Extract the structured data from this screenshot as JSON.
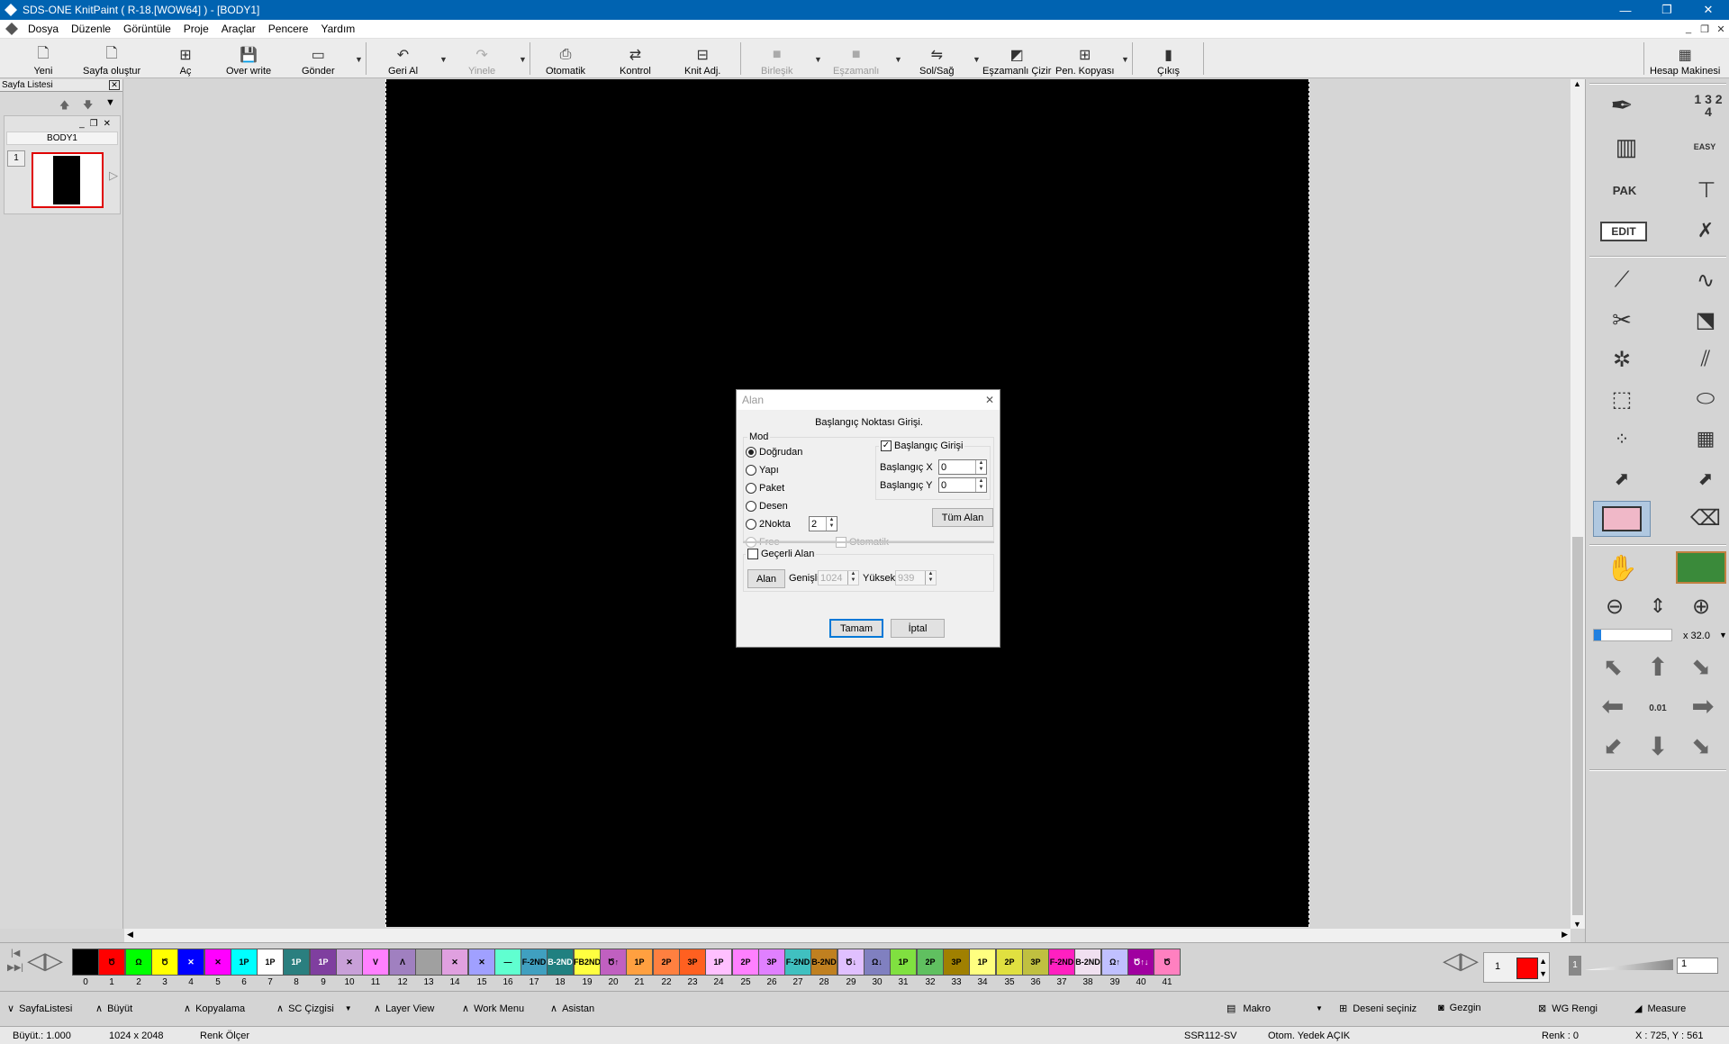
{
  "app": {
    "title": "SDS-ONE KnitPaint ( R-18.[WOW64] ) - [BODY1]"
  },
  "menu": [
    "Dosya",
    "Düzenle",
    "Görüntüle",
    "Proje",
    "Araçlar",
    "Pencere",
    "Yardım"
  ],
  "toolbar": {
    "yeni": "Yeni",
    "sayfa": "Sayfa oluştur",
    "ac": "Aç",
    "overwrite": "Over write",
    "gonder": "Gönder",
    "geri": "Geri Al",
    "yinele": "Yinele",
    "otomatik": "Otomatik",
    "kontrol": "Kontrol",
    "knit": "Knit Adj.",
    "birlesik": "Birleşik",
    "eszamanli": "Eşzamanlı",
    "solsag": "Sol/Sağ",
    "eszcizir": "Eşzamanlı Çizir",
    "penkopya": "Pen. Kopyası",
    "cikis": "Çıkış",
    "hesap": "Hesap Makinesi"
  },
  "left_panel": {
    "title": "Sayfa Listesi",
    "page_name": "BODY1",
    "page_number": "1"
  },
  "right_panel": {
    "edit_label": "EDIT",
    "easy_label": "EASY",
    "pak_label": "PAK",
    "num_label": "1 3 2 4",
    "zoom": "x 32.0",
    "step_label": "0.01"
  },
  "dialog": {
    "title": "Alan",
    "heading": "Başlangıç Noktası Girişi.",
    "mod_label": "Mod",
    "modes": [
      "Doğrudan",
      "Yapı",
      "Paket",
      "Desen",
      "2Nokta",
      "Free"
    ],
    "two_point_value": "2",
    "otomatik": "Otomatik",
    "start_entry": "Başlangıç Girişi",
    "start_x_label": "Başlangıç X",
    "start_x": "0",
    "start_y_label": "Başlangıç Y",
    "start_y": "0",
    "all_area": "Tüm Alan",
    "current_area": "Geçerli Alan",
    "alan_btn": "Alan",
    "width_label": "Genişlik",
    "width": "1024",
    "height_label": "Yükseklik",
    "height": "939",
    "ok": "Tamam",
    "cancel": "İptal"
  },
  "palette": [
    {
      "n": "0",
      "c": "#000000",
      "t": ""
    },
    {
      "n": "1",
      "c": "#ff0000",
      "t": "Ծ"
    },
    {
      "n": "2",
      "c": "#00ff00",
      "t": "Ω"
    },
    {
      "n": "3",
      "c": "#ffff00",
      "t": "Ծ"
    },
    {
      "n": "4",
      "c": "#0000ff",
      "t": "✕"
    },
    {
      "n": "5",
      "c": "#ff00ff",
      "t": "✕"
    },
    {
      "n": "6",
      "c": "#00ffff",
      "t": "1P"
    },
    {
      "n": "7",
      "c": "#ffffff",
      "t": "1P"
    },
    {
      "n": "8",
      "c": "#2a7f7f",
      "t": "1P"
    },
    {
      "n": "9",
      "c": "#7f3f9f",
      "t": "1P"
    },
    {
      "n": "10",
      "c": "#c8a0d8",
      "t": "✕"
    },
    {
      "n": "11",
      "c": "#ff80ff",
      "t": "V"
    },
    {
      "n": "12",
      "c": "#a080c0",
      "t": "Λ"
    },
    {
      "n": "13",
      "c": "#a0a0a0",
      "t": ""
    },
    {
      "n": "14",
      "c": "#e0a0e0",
      "t": "✕"
    },
    {
      "n": "15",
      "c": "#a0a0ff",
      "t": "✕"
    },
    {
      "n": "16",
      "c": "#60ffd0",
      "t": "—"
    },
    {
      "n": "17",
      "c": "#40a0c0",
      "t": "F-2ND"
    },
    {
      "n": "18",
      "c": "#208080",
      "t": "B-2ND"
    },
    {
      "n": "19",
      "c": "#ffff40",
      "t": "FB2ND"
    },
    {
      "n": "20",
      "c": "#c060c0",
      "t": "Ծ↑"
    },
    {
      "n": "21",
      "c": "#ffa040",
      "t": "1P"
    },
    {
      "n": "22",
      "c": "#ff8040",
      "t": "2P"
    },
    {
      "n": "23",
      "c": "#ff6020",
      "t": "3P"
    },
    {
      "n": "24",
      "c": "#ffc0ff",
      "t": "1P"
    },
    {
      "n": "25",
      "c": "#ff80ff",
      "t": "2P"
    },
    {
      "n": "26",
      "c": "#e080ff",
      "t": "3P"
    },
    {
      "n": "27",
      "c": "#40c0c0",
      "t": "F-2ND"
    },
    {
      "n": "28",
      "c": "#c08020",
      "t": "B-2ND"
    },
    {
      "n": "29",
      "c": "#e0c0ff",
      "t": "Ծ↓"
    },
    {
      "n": "30",
      "c": "#8080c0",
      "t": "Ω↓"
    },
    {
      "n": "31",
      "c": "#80e040",
      "t": "1P"
    },
    {
      "n": "32",
      "c": "#60c060",
      "t": "2P"
    },
    {
      "n": "33",
      "c": "#a08000",
      "t": "3P"
    },
    {
      "n": "34",
      "c": "#ffff80",
      "t": "1P"
    },
    {
      "n": "35",
      "c": "#e0e040",
      "t": "2P"
    },
    {
      "n": "36",
      "c": "#c0c040",
      "t": "3P"
    },
    {
      "n": "37",
      "c": "#ff20c0",
      "t": "F-2ND"
    },
    {
      "n": "38",
      "c": "#f0e0f0",
      "t": "B-2ND"
    },
    {
      "n": "39",
      "c": "#c0c0ff",
      "t": "Ω↑"
    },
    {
      "n": "40",
      "c": "#a000a0",
      "t": "Ծ↑↓"
    },
    {
      "n": "41",
      "c": "#ff80c0",
      "t": "Ծ"
    }
  ],
  "palette_right": {
    "num": "1",
    "level": "1",
    "current_color": "#ff0000"
  },
  "bottom": {
    "sayfalistesi": "SayfaListesi",
    "buyut": "Büyüt",
    "kopyalama": "Kopyalama",
    "sc": "SC Çizgisi",
    "layer": "Layer View",
    "work": "Work Menu",
    "asistan": "Asistan",
    "makro": "Makro",
    "deseni": "Deseni seçiniz",
    "gezgin": "Gezgin",
    "wg": "WG Rengi",
    "measure": "Measure"
  },
  "status": {
    "zoom": "Büyüt.: 1.000",
    "size": "1024 x 2048",
    "renk_olcer": "Renk Ölçer",
    "model": "SSR112-SV",
    "yedek": "Otom. Yedek AÇIK",
    "renk": "Renk :  0",
    "coords": "X : 725, Y : 561"
  }
}
